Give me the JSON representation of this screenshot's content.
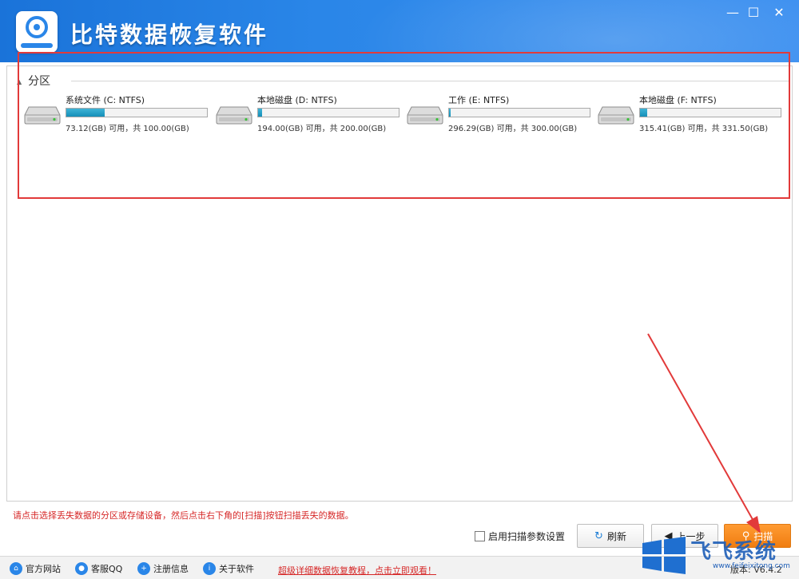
{
  "window": {
    "title": "比特数据恢复软件",
    "minimize_glyph": "—",
    "maximize_glyph": "☐",
    "close_glyph": "✕"
  },
  "section": {
    "title": "分区"
  },
  "partitions": [
    {
      "name": "系统文件 (C: NTFS)",
      "info": "73.12(GB) 可用，共 100.00(GB)",
      "used_fraction": 0.27
    },
    {
      "name": "本地磁盘 (D: NTFS)",
      "info": "194.00(GB) 可用，共 200.00(GB)",
      "used_fraction": 0.03
    },
    {
      "name": "工作 (E: NTFS)",
      "info": "296.29(GB) 可用，共 300.00(GB)",
      "used_fraction": 0.012
    },
    {
      "name": "本地磁盘 (F: NTFS)",
      "info": "315.41(GB) 可用，共 331.50(GB)",
      "used_fraction": 0.05
    }
  ],
  "hint": "请点击选择丢失数据的分区或存储设备，然后点击右下角的[扫描]按钮扫描丢失的数据。",
  "controls": {
    "scan_settings_label": "启用扫描参数设置",
    "refresh_label": "刷新",
    "prev_label": "上一步",
    "scan_label": "扫描"
  },
  "footer": {
    "website": "官方网站",
    "support_qq": "客服QQ",
    "register": "注册信息",
    "about": "关于软件",
    "tutorial_link": "超级详细数据恢复教程，点击立即观看！",
    "version": "版本: V6.4.2"
  },
  "watermark": {
    "brand": "飞飞系统",
    "url": "www.feifeixitong.com"
  },
  "colors": {
    "title_bar": "#2a86e8",
    "accent_orange": "#f07d10",
    "alert_red": "#d62828",
    "usage_fill": "#168fb8"
  }
}
